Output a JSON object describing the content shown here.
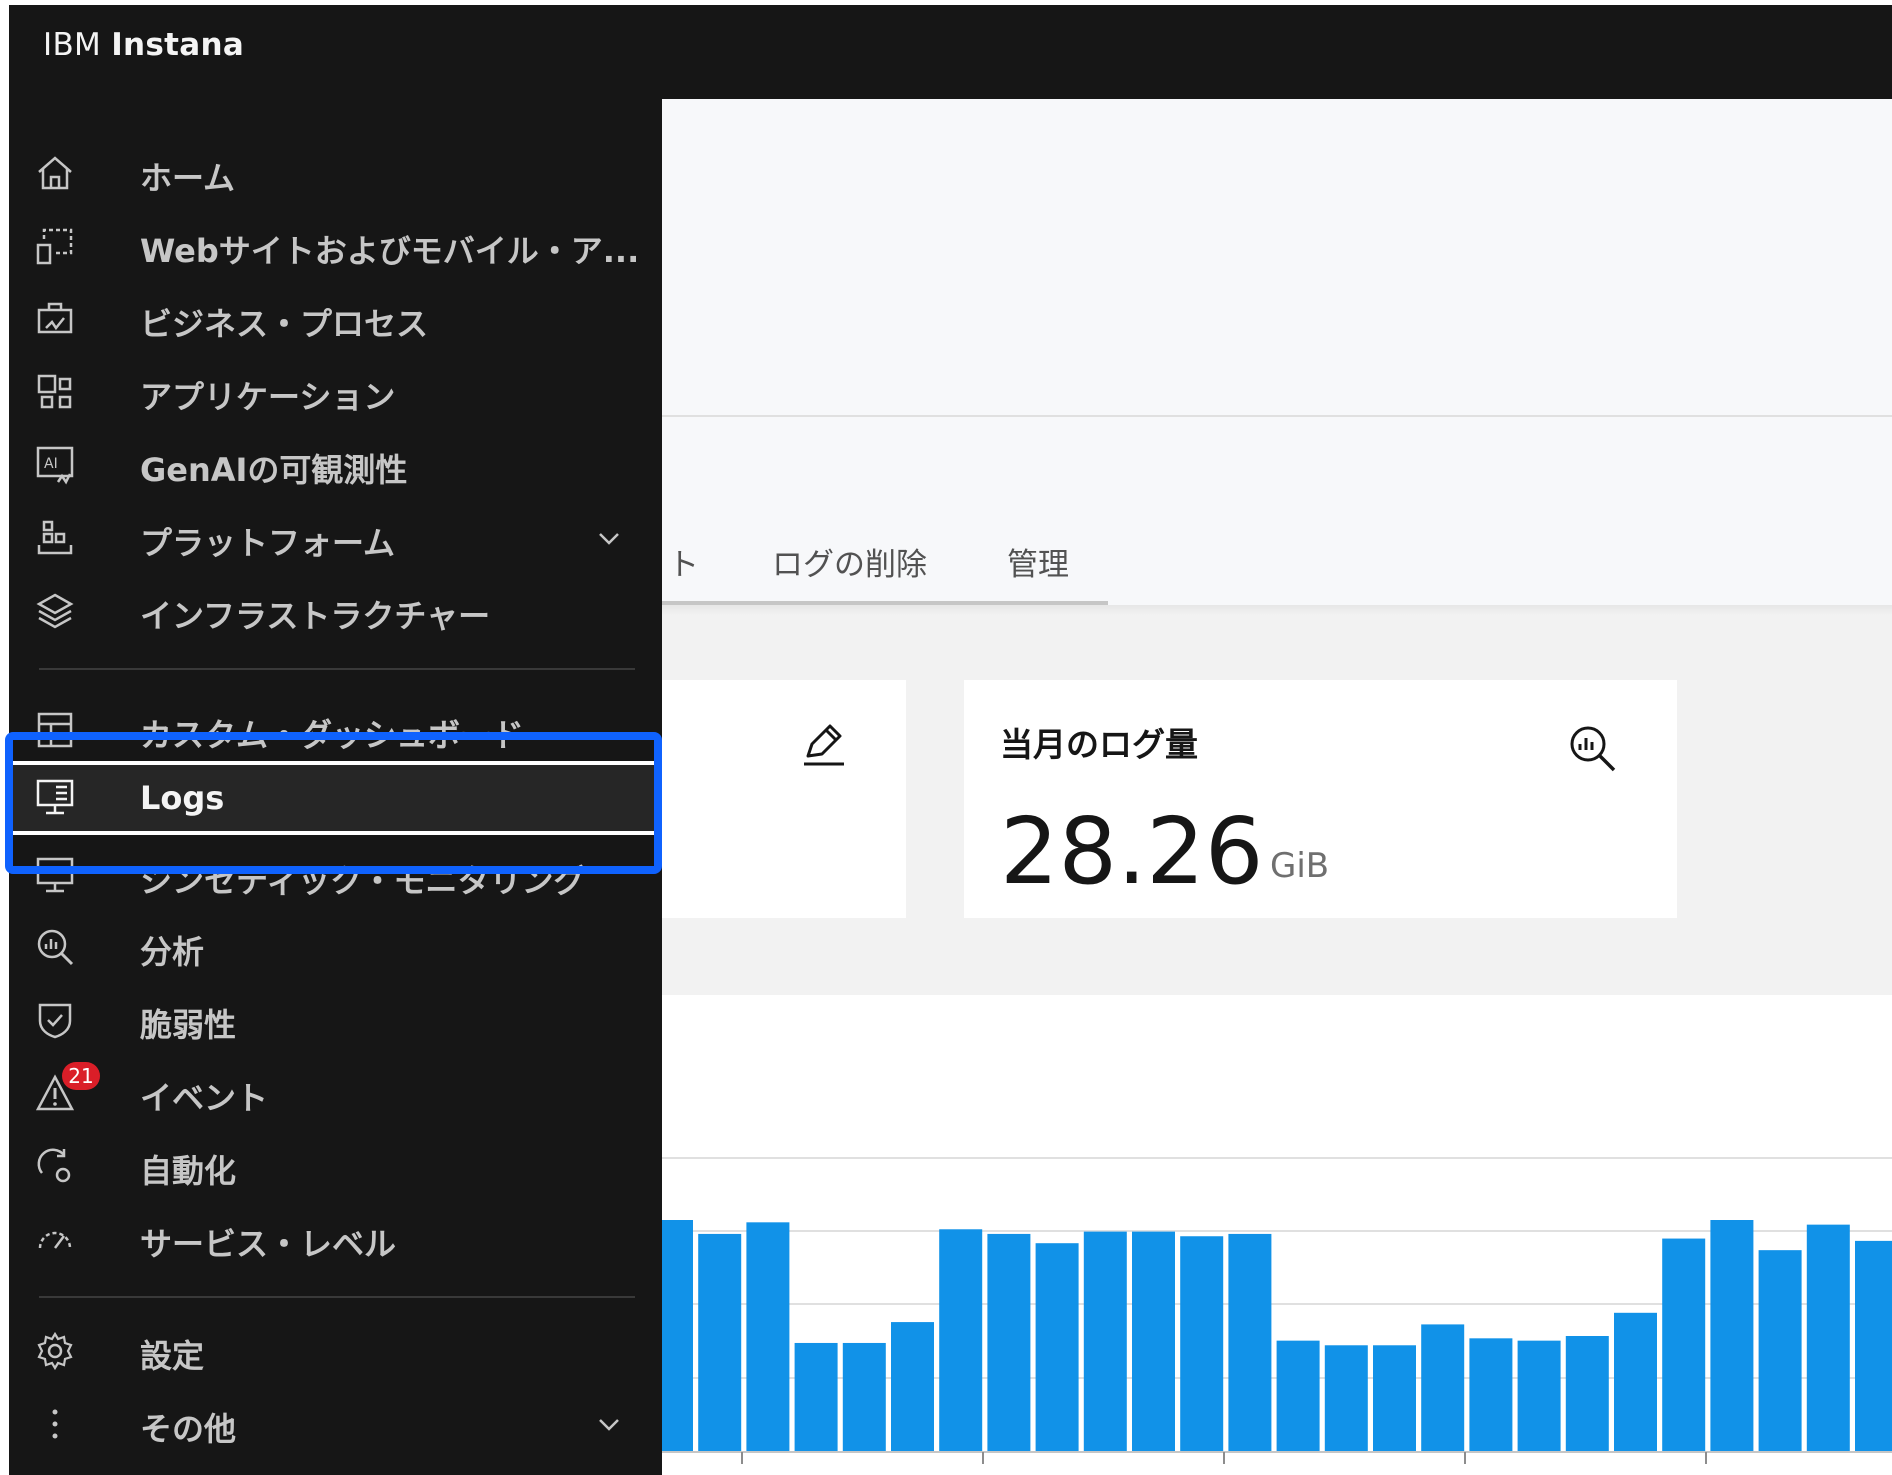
{
  "app": {
    "brand_prefix": "IBM",
    "brand_name": "Instana"
  },
  "sidebar": {
    "items": [
      {
        "label": "ホーム",
        "icon": "home-icon"
      },
      {
        "label": "Webサイトおよびモバイル・ア...",
        "icon": "website-mobile-icon"
      },
      {
        "label": "ビジネス・プロセス",
        "icon": "business-process-icon"
      },
      {
        "label": "アプリケーション",
        "icon": "applications-icon"
      },
      {
        "label": "GenAIの可観測性",
        "icon": "ai-observability-icon"
      },
      {
        "label": "プラットフォーム",
        "icon": "platform-icon",
        "expandable": true
      },
      {
        "label": "インフラストラクチャー",
        "icon": "layers-icon"
      },
      {
        "label": "カスタム・ダッシュボード",
        "icon": "dashboard-icon"
      },
      {
        "label": "Logs",
        "icon": "logs-icon",
        "active": true
      },
      {
        "label": "シンセティック・モニタリング",
        "icon": "synthetic-monitoring-icon"
      },
      {
        "label": "分析",
        "icon": "analyze-icon"
      },
      {
        "label": "脆弱性",
        "icon": "shield-icon"
      },
      {
        "label": "イベント",
        "icon": "warning-icon",
        "badge": "21"
      },
      {
        "label": "自動化",
        "icon": "automation-icon"
      },
      {
        "label": "サービス・レベル",
        "icon": "speedometer-icon"
      },
      {
        "label": "設定",
        "icon": "gear-icon"
      },
      {
        "label": "その他",
        "icon": "more-vertical-icon",
        "expandable": true
      }
    ]
  },
  "tabs": {
    "partial": "ト",
    "delete_logs": "ログの削除",
    "manage": "管理"
  },
  "cards": {
    "monthly_volume": {
      "title": "当月のログ量",
      "value": "28.26",
      "unit": "GiB"
    }
  },
  "colors": {
    "accent": "#0f62fe",
    "bar": "#1192e8",
    "sidebar_bg": "#161616",
    "badge": "#da1e28"
  },
  "chart_data": {
    "type": "bar",
    "values": [
      100,
      94,
      99,
      47,
      47,
      56,
      96,
      94,
      90,
      95,
      95,
      93,
      94,
      48,
      46,
      46,
      55,
      49,
      48,
      50,
      60,
      92,
      100,
      87,
      98,
      91
    ]
  }
}
